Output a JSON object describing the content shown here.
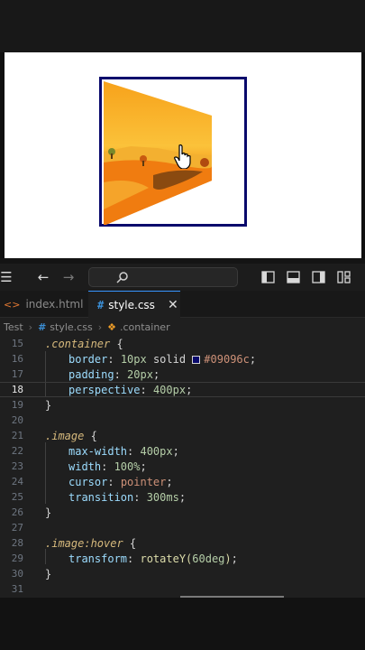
{
  "toolbar": {
    "menu_icon": "menu-icon",
    "back_icon": "arrow-left-icon",
    "forward_icon": "arrow-right-icon",
    "search_icon": "search-icon",
    "layout_icons": [
      "sidebar-left-icon",
      "panel-bottom-icon",
      "sidebar-right-icon",
      "layout-grid-icon"
    ]
  },
  "tabs": [
    {
      "label": "index.html",
      "active": false
    },
    {
      "label": "style.css",
      "active": true
    }
  ],
  "breadcrumb": {
    "folder": "Test",
    "file": "style.css",
    "symbol": ".container"
  },
  "editor": {
    "current_line": "18",
    "lines": [
      {
        "n": "15",
        "sel": ".container",
        "brace": " {"
      },
      {
        "n": "16",
        "prop": "border",
        "num": "10px",
        "val": " solid ",
        "color": "#09096c"
      },
      {
        "n": "17",
        "prop": "padding",
        "num": "20px"
      },
      {
        "n": "18",
        "prop": "perspective",
        "num": "400px"
      },
      {
        "n": "19",
        "close": "}"
      },
      {
        "n": "20"
      },
      {
        "n": "21",
        "sel": ".image",
        "brace": " {"
      },
      {
        "n": "22",
        "prop": "max-width",
        "num": "400px"
      },
      {
        "n": "23",
        "prop": "width",
        "num": "100%"
      },
      {
        "n": "24",
        "prop": "cursor",
        "val": "pointer"
      },
      {
        "n": "25",
        "prop": "transition",
        "num": "300ms"
      },
      {
        "n": "26",
        "close": "}"
      },
      {
        "n": "27"
      },
      {
        "n": "28",
        "sel": ".image:hover",
        "brace": " {"
      },
      {
        "n": "29",
        "prop": "transform",
        "fn": "rotateY(",
        "num": "60deg",
        "fnclose": ")"
      },
      {
        "n": "30",
        "close": "}"
      },
      {
        "n": "31"
      }
    ]
  },
  "colors": {
    "container_border": "#09096c",
    "tab_accent": "#3794ff"
  }
}
